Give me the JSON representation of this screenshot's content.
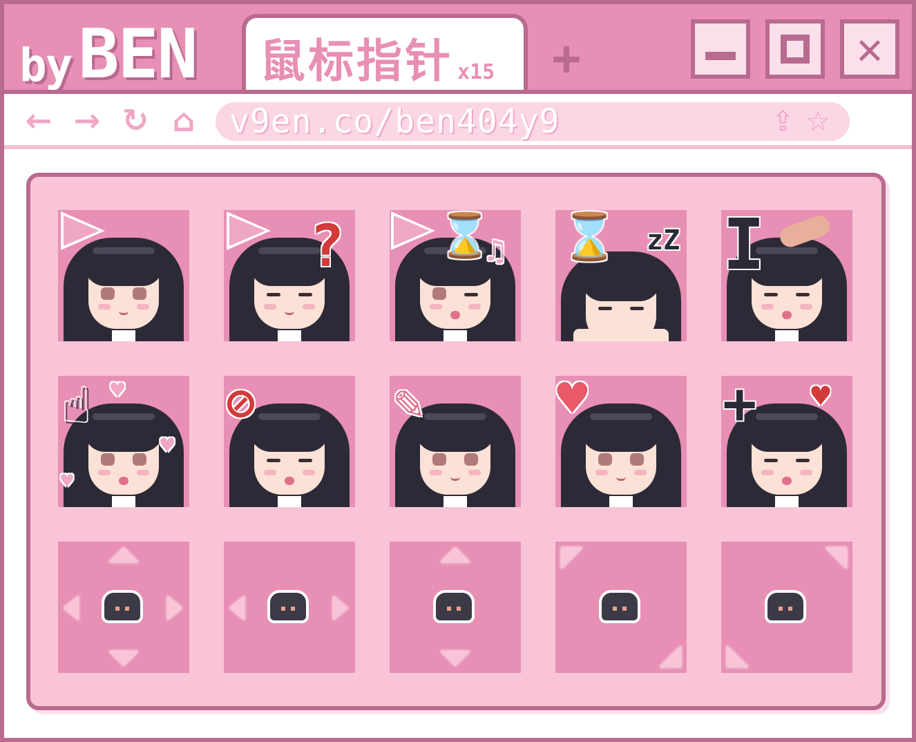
{
  "titlebar": {
    "brand_by": "by",
    "brand_name": "BEN",
    "tab_title": "鼠标指针",
    "tab_count": "x15",
    "new_tab": "+",
    "min_icon": "minimize-icon",
    "max_icon": "maximize-icon",
    "close_glyph": "✕"
  },
  "navbar": {
    "back": "←",
    "forward": "→",
    "reload": "↻",
    "home": "⌂",
    "url": "v9en.co/ben404y9",
    "share": "⇪",
    "bookmark": "☆"
  },
  "cursors": [
    {
      "icon": "arrow-cursor-icon",
      "expression": "smile"
    },
    {
      "icon": "help-cursor-icon",
      "overlay": "?",
      "expression": "closed"
    },
    {
      "icon": "working-cursor-icon",
      "overlay": "⌛♫",
      "expression": "closed-open"
    },
    {
      "icon": "busy-cursor-icon",
      "overlay": "⌛zZ",
      "expression": "sleep"
    },
    {
      "icon": "text-cursor-icon",
      "overlay": "I",
      "expression": "blush"
    },
    {
      "icon": "hand-cursor-icon",
      "overlay": "♥",
      "expression": "open"
    },
    {
      "icon": "unavailable-cursor-icon",
      "overlay": "⊘",
      "expression": "closed-open"
    },
    {
      "icon": "pen-cursor-icon",
      "expression": "smile"
    },
    {
      "icon": "heart-cursor-icon",
      "overlay": "♥",
      "expression": "smile"
    },
    {
      "icon": "crosshair-cursor-icon",
      "overlay": "+",
      "expression": "closed-open"
    },
    {
      "icon": "move-cursor-icon"
    },
    {
      "icon": "horizontal-resize-cursor-icon"
    },
    {
      "icon": "vertical-resize-cursor-icon"
    },
    {
      "icon": "diagonal-resize-1-cursor-icon"
    },
    {
      "icon": "diagonal-resize-2-cursor-icon"
    }
  ],
  "colors": {
    "frame": "#b96a8f",
    "accent": "#e88fb5",
    "panel": "#f9c4d7",
    "hair": "#2c2a36"
  },
  "sym": {
    "question": "?",
    "hourglass": "⌛",
    "note": "♫",
    "zz": "zZ",
    "ibeam": "I",
    "heart": "♥",
    "no": "⊘",
    "plus": "+",
    "hand": "☝",
    "pen": "✎"
  }
}
